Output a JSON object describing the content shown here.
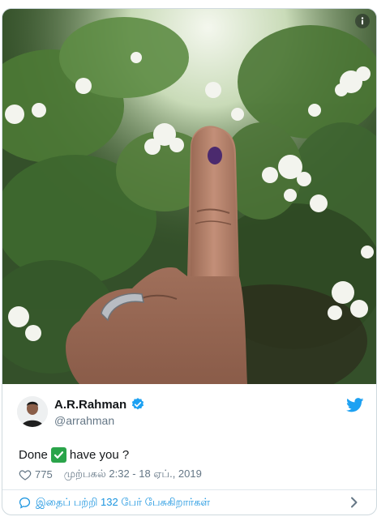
{
  "tweet": {
    "author_name": "A.R.Rahman",
    "author_handle": "@arrahman",
    "text_before": "Done",
    "text_after": "have you ?",
    "likes": "775",
    "timestamp": "முற்பகல் 2:32 - 18 ஏப்., 2019",
    "replies_link": "இதைப் பற்றி 132 பேர் பேசுகிறார்கள்"
  },
  "icons": {
    "info": "info-icon",
    "verified": "verified-badge-icon",
    "twitter": "twitter-bird-icon",
    "check": "check-mark-emoji-icon",
    "heart": "heart-icon",
    "reply": "speech-bubble-icon",
    "chevron": "chevron-right-icon"
  },
  "colors": {
    "brand_blue": "#1da1f2",
    "link_blue": "#1b95e0",
    "text_dark": "#14171a",
    "text_muted": "#657786",
    "check_green": "#2aa44a"
  }
}
